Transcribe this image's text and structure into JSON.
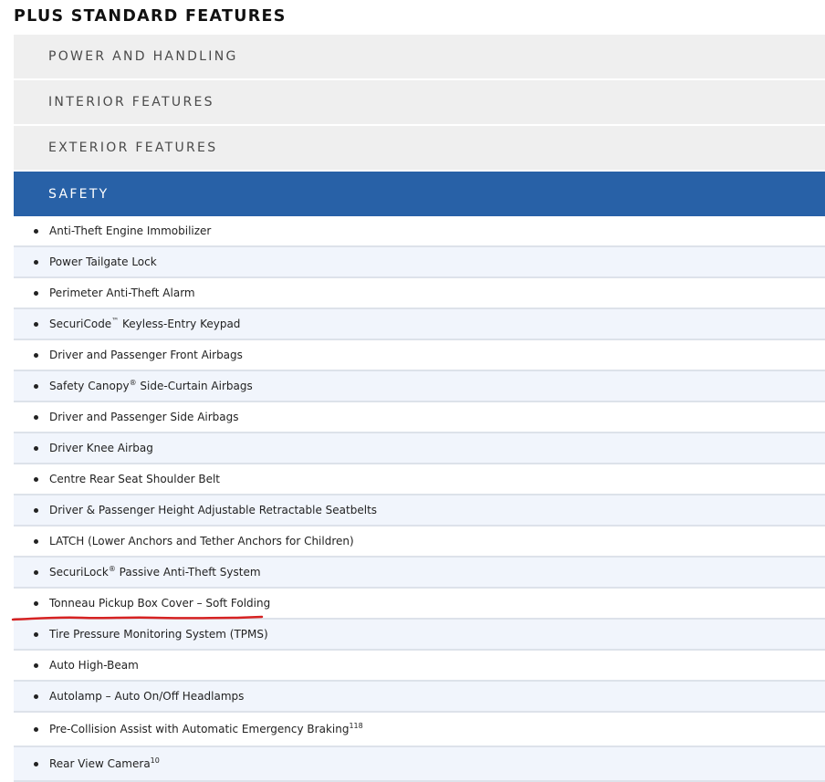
{
  "page": {
    "title": "PLUS STANDARD FEATURES"
  },
  "sections": [
    {
      "label": "POWER AND HANDLING"
    },
    {
      "label": "INTERIOR FEATURES"
    },
    {
      "label": "EXTERIOR FEATURES"
    },
    {
      "label": "SAFETY"
    }
  ],
  "active_section": "SAFETY",
  "safety_features": [
    {
      "text": "Anti-Theft Engine Immobilizer",
      "sup": ""
    },
    {
      "text": "Power Tailgate Lock",
      "sup": ""
    },
    {
      "text": "Perimeter Anti-Theft Alarm",
      "sup": ""
    },
    {
      "text": "SecuriCode",
      "sup": "™",
      "rest": " Keyless-Entry Keypad"
    },
    {
      "text": "Driver and Passenger Front Airbags",
      "sup": ""
    },
    {
      "text": "Safety Canopy",
      "sup": "®",
      "rest": " Side-Curtain Airbags"
    },
    {
      "text": "Driver and Passenger Side Airbags",
      "sup": ""
    },
    {
      "text": "Driver Knee Airbag",
      "sup": ""
    },
    {
      "text": "Centre Rear Seat Shoulder Belt",
      "sup": ""
    },
    {
      "text": "Driver & Passenger Height Adjustable Retractable Seatbelts",
      "sup": ""
    },
    {
      "text": "LATCH (Lower Anchors and Tether Anchors for Children)",
      "sup": ""
    },
    {
      "text": "SecuriLock",
      "sup": "®",
      "rest": " Passive Anti-Theft System"
    },
    {
      "text": "Tonneau Pickup Box Cover – Soft Folding",
      "sup": ""
    },
    {
      "text": "Tire Pressure Monitoring System (TPMS)",
      "sup": ""
    },
    {
      "text": "Auto High-Beam",
      "sup": ""
    },
    {
      "text": "Autolamp – Auto On/Off Headlamps",
      "sup": ""
    },
    {
      "text": "Pre-Collision Assist with Automatic Emergency Braking",
      "sup": "118"
    },
    {
      "text": "Rear View Camera",
      "sup": "10"
    }
  ],
  "colors": {
    "accent": "#2861a7",
    "header_bg": "#efefef",
    "row_alt_bg": "#f1f5fc",
    "annotation": "#d62222"
  }
}
